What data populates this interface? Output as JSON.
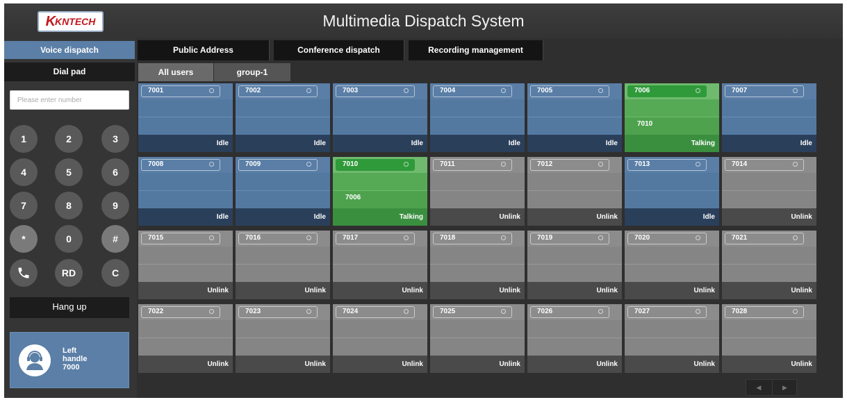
{
  "header": {
    "logo_mark": "K",
    "logo_text": "KNTECH",
    "title": "Multimedia Dispatch System"
  },
  "sidebar": {
    "voice_tab": "Voice dispatch",
    "dialpad_title": "Dial pad",
    "number_placeholder": "Please enter number",
    "keys": [
      "1",
      "2",
      "3",
      "4",
      "5",
      "6",
      "7",
      "8",
      "9",
      "*",
      "0",
      "#",
      "RD",
      "C"
    ],
    "hangup_label": "Hang up",
    "handle": {
      "line1": "Left",
      "line2": "handle",
      "number": "7000"
    }
  },
  "tabs": [
    "Public Address",
    "Conference dispatch",
    "Recording management"
  ],
  "groups": [
    "All users",
    "group-1"
  ],
  "extensions": [
    {
      "number": "7001",
      "status": "Idle"
    },
    {
      "number": "7002",
      "status": "Idle"
    },
    {
      "number": "7003",
      "status": "Idle"
    },
    {
      "number": "7004",
      "status": "Idle"
    },
    {
      "number": "7005",
      "status": "Idle"
    },
    {
      "number": "7006",
      "status": "Talking",
      "peer": "7010"
    },
    {
      "number": "7007",
      "status": "Idle"
    },
    {
      "number": "7008",
      "status": "Idle"
    },
    {
      "number": "7009",
      "status": "Idle"
    },
    {
      "number": "7010",
      "status": "Talking",
      "peer": "7006"
    },
    {
      "number": "7011",
      "status": "Unlink"
    },
    {
      "number": "7012",
      "status": "Unlink"
    },
    {
      "number": "7013",
      "status": "Idle"
    },
    {
      "number": "7014",
      "status": "Unlink"
    },
    {
      "number": "7015",
      "status": "Unlink"
    },
    {
      "number": "7016",
      "status": "Unlink"
    },
    {
      "number": "7017",
      "status": "Unlink"
    },
    {
      "number": "7018",
      "status": "Unlink"
    },
    {
      "number": "7019",
      "status": "Unlink"
    },
    {
      "number": "7020",
      "status": "Unlink"
    },
    {
      "number": "7021",
      "status": "Unlink"
    },
    {
      "number": "7022",
      "status": "Unlink"
    },
    {
      "number": "7023",
      "status": "Unlink"
    },
    {
      "number": "7024",
      "status": "Unlink"
    },
    {
      "number": "7025",
      "status": "Unlink"
    },
    {
      "number": "7026",
      "status": "Unlink"
    },
    {
      "number": "7027",
      "status": "Unlink"
    },
    {
      "number": "7028",
      "status": "Unlink"
    }
  ],
  "pager": {
    "prev": "◀",
    "next": "▶"
  }
}
